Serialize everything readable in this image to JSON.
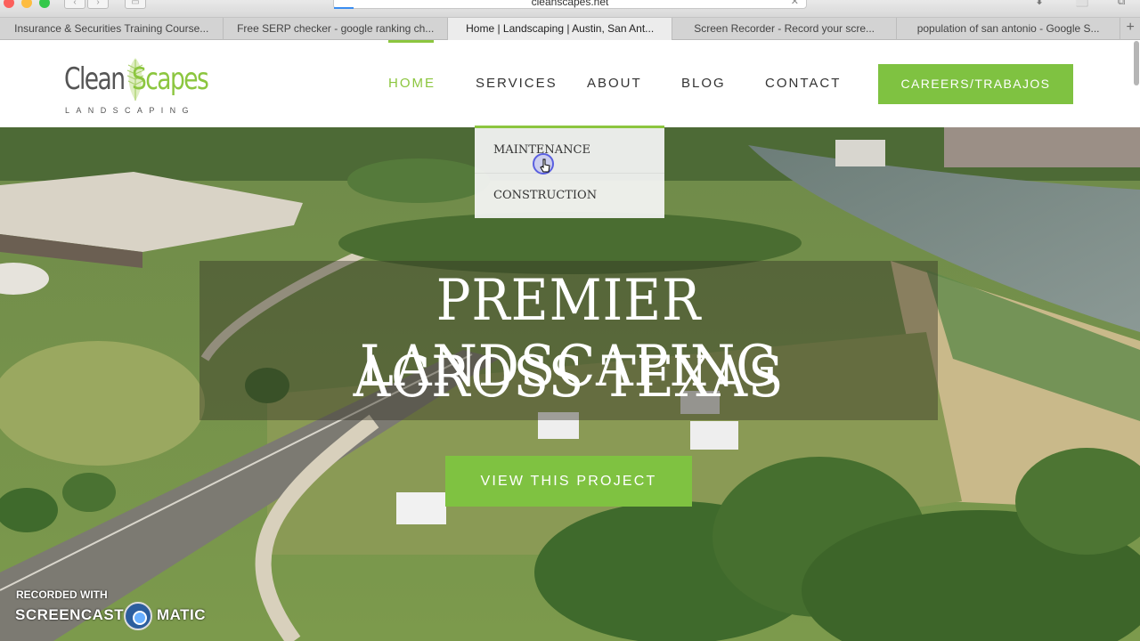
{
  "browser": {
    "url": "cleanscapes.net",
    "tabs": [
      {
        "label": "Insurance & Securities Training Course..."
      },
      {
        "label": "Free SERP checker - google ranking ch..."
      },
      {
        "label": "Home | Landscaping | Austin, San Ant..."
      },
      {
        "label": "Screen Recorder - Record your scre..."
      },
      {
        "label": "population of san antonio - Google S..."
      }
    ],
    "new_tab": "+"
  },
  "logo": {
    "clean": "Clean",
    "scapes": "Scapes",
    "sub": "LANDSCAPING"
  },
  "nav": {
    "home": "HOME",
    "services": "SERVICES",
    "about": "ABOUT",
    "blog": "BLOG",
    "contact": "CONTACT",
    "careers": "CAREERS/TRABAJOS"
  },
  "dropdown": {
    "item1": "MAINTENANCE",
    "item2": "CONSTRUCTION"
  },
  "hero": {
    "line1": "PREMIER LANDSCAPING",
    "line2": "ACROSS TEXAS",
    "cta": "VIEW THIS PROJECT"
  },
  "watermark": {
    "recorded": "RECORDED WITH",
    "brand_left": "SCREENCAST",
    "brand_right": "MATIC"
  },
  "colors": {
    "accent": "#8cc63f",
    "button": "#7fc241"
  }
}
